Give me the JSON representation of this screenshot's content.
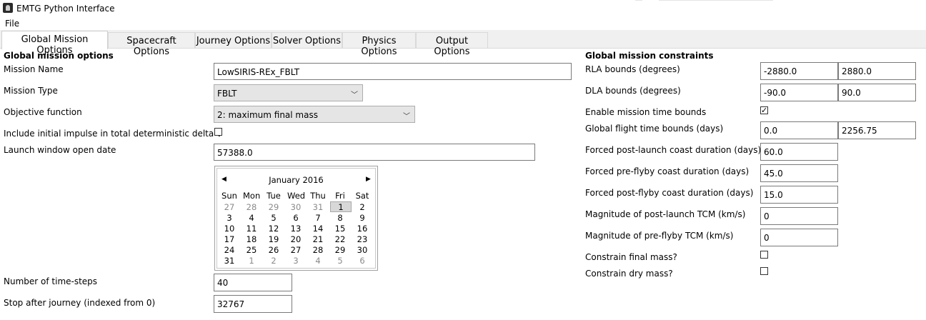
{
  "window": {
    "title": "EMTG Python Interface"
  },
  "menu": {
    "file": "File"
  },
  "tabs": [
    {
      "label": "Global Mission Options",
      "active": true
    },
    {
      "label": "Spacecraft Options"
    },
    {
      "label": "Journey Options"
    },
    {
      "label": "Solver Options"
    },
    {
      "label": "Physics Options"
    },
    {
      "label": "Output Options"
    }
  ],
  "left": {
    "heading": "Global mission options",
    "mission_name": {
      "label": "Mission Name",
      "value": "LowSIRIS-REx_FBLT"
    },
    "mission_type": {
      "label": "Mission Type",
      "value": "FBLT"
    },
    "objective": {
      "label": "Objective function",
      "value": "2: maximum final mass"
    },
    "include_impulse": {
      "label": "Include initial impulse in total deterministic delta-v",
      "checked": false
    },
    "launch_window": {
      "label": "Launch window open date",
      "value": "57388.0"
    },
    "calendar": {
      "month": "January 2016",
      "prev": "◀",
      "next": "▶",
      "weekdays": [
        "Sun",
        "Mon",
        "Tue",
        "Wed",
        "Thu",
        "Fri",
        "Sat"
      ],
      "weeks": [
        [
          "27",
          "28",
          "29",
          "30",
          "31",
          "1",
          "2"
        ],
        [
          "3",
          "4",
          "5",
          "6",
          "7",
          "8",
          "9"
        ],
        [
          "10",
          "11",
          "12",
          "13",
          "14",
          "15",
          "16"
        ],
        [
          "17",
          "18",
          "19",
          "20",
          "21",
          "22",
          "23"
        ],
        [
          "24",
          "25",
          "26",
          "27",
          "28",
          "29",
          "30"
        ],
        [
          "31",
          "1",
          "2",
          "3",
          "4",
          "5",
          "6"
        ]
      ],
      "selected": "1"
    },
    "timesteps": {
      "label": "Number of time-steps",
      "value": "40"
    },
    "stop_after": {
      "label": "Stop after journey (indexed from 0)",
      "value": "32767"
    }
  },
  "right": {
    "heading": "Global mission constraints",
    "rla": {
      "label": "RLA bounds (degrees)",
      "min": "-2880.0",
      "max": "2880.0"
    },
    "dla": {
      "label": "DLA bounds (degrees)",
      "min": "-90.0",
      "max": "90.0"
    },
    "enable_time_bounds": {
      "label": "Enable mission time bounds",
      "checked": true
    },
    "flight_time": {
      "label": "Global flight time bounds (days)",
      "min": "0.0",
      "max": "2256.75"
    },
    "post_launch_coast": {
      "label": "Forced post-launch coast duration (days)",
      "value": "60.0"
    },
    "pre_flyby_coast": {
      "label": "Forced pre-flyby coast duration (days)",
      "value": "45.0"
    },
    "post_flyby_coast": {
      "label": "Forced post-flyby coast duration (days)",
      "value": "15.0"
    },
    "post_launch_tcm": {
      "label": "Magnitude of post-launch TCM (km/s)",
      "value": "0"
    },
    "pre_flyby_tcm": {
      "label": "Magnitude of pre-flyby TCM (km/s)",
      "value": "0"
    },
    "constrain_final_mass": {
      "label": "Constrain final mass?",
      "checked": false
    },
    "constrain_dry_mass": {
      "label": "Constrain dry mass?",
      "checked": false
    }
  }
}
